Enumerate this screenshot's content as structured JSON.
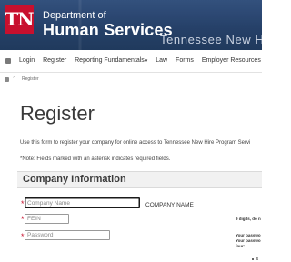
{
  "header": {
    "logo_text": "TN",
    "dept_line1": "Department of",
    "dept_line2": "Human Services",
    "site_title": "Tennessee New Hire R"
  },
  "nav": {
    "items": [
      {
        "label": "Login"
      },
      {
        "label": "Register"
      },
      {
        "label": "Reporting Fundamentals"
      },
      {
        "label": "Law"
      },
      {
        "label": "Forms"
      },
      {
        "label": "Employer Resources"
      }
    ],
    "dropdown_caret": "▾"
  },
  "breadcrumb": {
    "separator": "›",
    "current": "Register"
  },
  "page": {
    "title": "Register",
    "intro": "Use this form to register your company for online access to Tennessee New Hire Program Servi",
    "note": "*Note: Fields marked with an asterisk indicates required fields."
  },
  "section": {
    "title": "Company Information"
  },
  "form": {
    "required_mark": "*",
    "company_name": {
      "placeholder": "Company Name",
      "value": "",
      "label": "COMPANY NAME"
    },
    "fein": {
      "placeholder": "FEIN",
      "value": "",
      "hint": "9 digits, do n"
    },
    "password": {
      "placeholder": "Password",
      "value": "",
      "hint_line1": "Your passwo",
      "hint_line2": "Your passwo",
      "hint_line3": "four:",
      "bullet": "S"
    }
  }
}
